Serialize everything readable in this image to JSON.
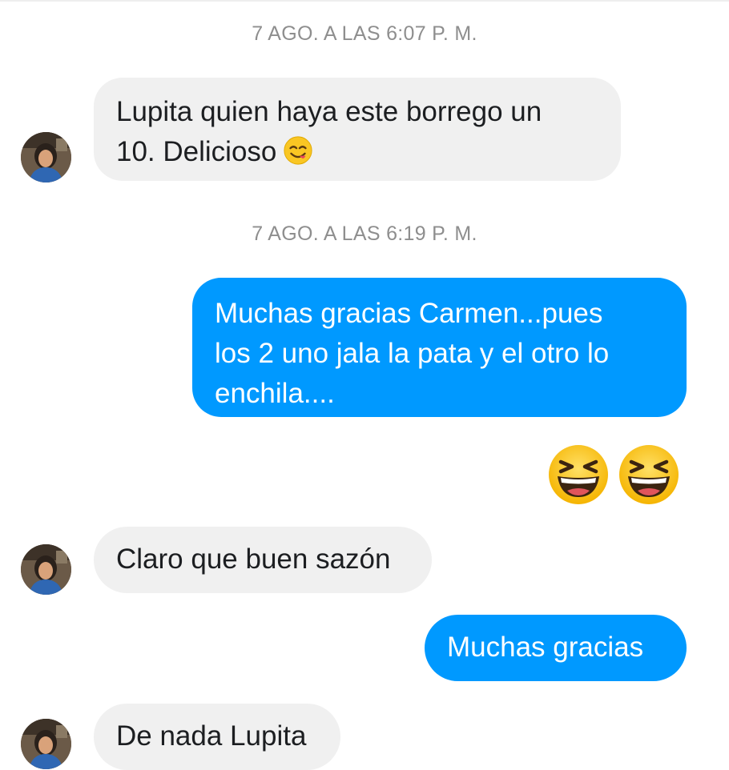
{
  "conversation": {
    "timestamps": {
      "first": "7 AGO. A LAS 6:07 P. M.",
      "second": "7 AGO. A LAS 6:19 P. M."
    },
    "messages": [
      {
        "direction": "incoming",
        "line1": "Lupita quien haya este borrego un",
        "line2": "10. Delicioso",
        "emoji": "savoring-food-emoji"
      },
      {
        "direction": "outgoing",
        "line1": "Muchas gracias Carmen...pues",
        "line2": "los 2 uno jala la pata y el otro lo",
        "line3": "enchila...."
      },
      {
        "direction": "outgoing",
        "emoji": [
          "grinning-squinting-emoji",
          "grinning-squinting-emoji"
        ]
      },
      {
        "direction": "incoming",
        "text": "Claro que buen sazón"
      },
      {
        "direction": "outgoing",
        "text": "Muchas gracias"
      },
      {
        "direction": "incoming",
        "text": "De nada Lupita"
      }
    ]
  },
  "colors": {
    "outgoing_bubble": "#0099ff",
    "incoming_bubble": "#f0f0f0",
    "timestamp_text": "#8e8e8e"
  }
}
